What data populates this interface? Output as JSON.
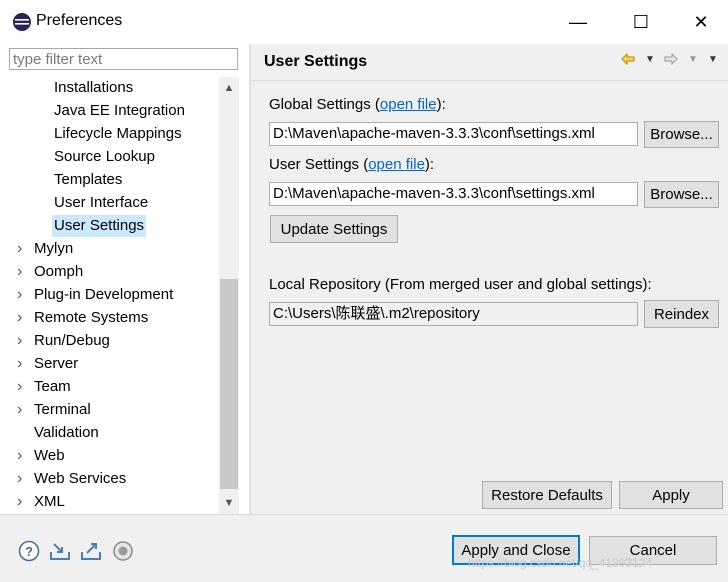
{
  "window": {
    "title": "Preferences",
    "controls": {
      "minimize": "—",
      "maximize": "☐",
      "close": "✕"
    }
  },
  "left": {
    "filter_placeholder": "type filter text",
    "tree": [
      {
        "label": "Installations",
        "level": 2,
        "expandable": false
      },
      {
        "label": "Java EE Integration",
        "level": 2,
        "expandable": false
      },
      {
        "label": "Lifecycle Mappings",
        "level": 2,
        "expandable": false
      },
      {
        "label": "Source Lookup",
        "level": 2,
        "expandable": false
      },
      {
        "label": "Templates",
        "level": 2,
        "expandable": false
      },
      {
        "label": "User Interface",
        "level": 2,
        "expandable": false
      },
      {
        "label": "User Settings",
        "level": 2,
        "expandable": false,
        "selected": true
      },
      {
        "label": "Mylyn",
        "level": 1,
        "expandable": true
      },
      {
        "label": "Oomph",
        "level": 1,
        "expandable": true
      },
      {
        "label": "Plug-in Development",
        "level": 1,
        "expandable": true
      },
      {
        "label": "Remote Systems",
        "level": 1,
        "expandable": true
      },
      {
        "label": "Run/Debug",
        "level": 1,
        "expandable": true
      },
      {
        "label": "Server",
        "level": 1,
        "expandable": true
      },
      {
        "label": "Team",
        "level": 1,
        "expandable": true
      },
      {
        "label": "Terminal",
        "level": 1,
        "expandable": true
      },
      {
        "label": "Validation",
        "level": 1,
        "expandable": false
      },
      {
        "label": "Web",
        "level": 1,
        "expandable": true
      },
      {
        "label": "Web Services",
        "level": 1,
        "expandable": true
      },
      {
        "label": "XML",
        "level": 1,
        "expandable": true
      }
    ]
  },
  "page": {
    "title": "User Settings",
    "global_settings": {
      "label_prefix": "Global Settings (",
      "link": "open file",
      "label_suffix": "):",
      "value": "D:\\Maven\\apache-maven-3.3.3\\conf\\settings.xml",
      "browse": "Browse..."
    },
    "user_settings": {
      "label_prefix": "User Settings (",
      "link": "open file",
      "label_suffix": "):",
      "value": "D:\\Maven\\apache-maven-3.3.3\\conf\\settings.xml",
      "browse": "Browse..."
    },
    "update_settings": "Update Settings",
    "local_repo": {
      "label": "Local Repository (From merged user and global settings):",
      "value": "C:\\Users\\陈联盛\\.m2\\repository",
      "reindex": "Reindex"
    },
    "restore_defaults": "Restore Defaults",
    "apply": "Apply"
  },
  "footer": {
    "apply_close": "Apply and Close",
    "cancel": "Cancel",
    "watermark": "https://blog.csdn.net/qq_41393124"
  },
  "colors": {
    "selection": "#cce8ff",
    "link": "#0066cc",
    "default_button_border": "#0078d7"
  }
}
